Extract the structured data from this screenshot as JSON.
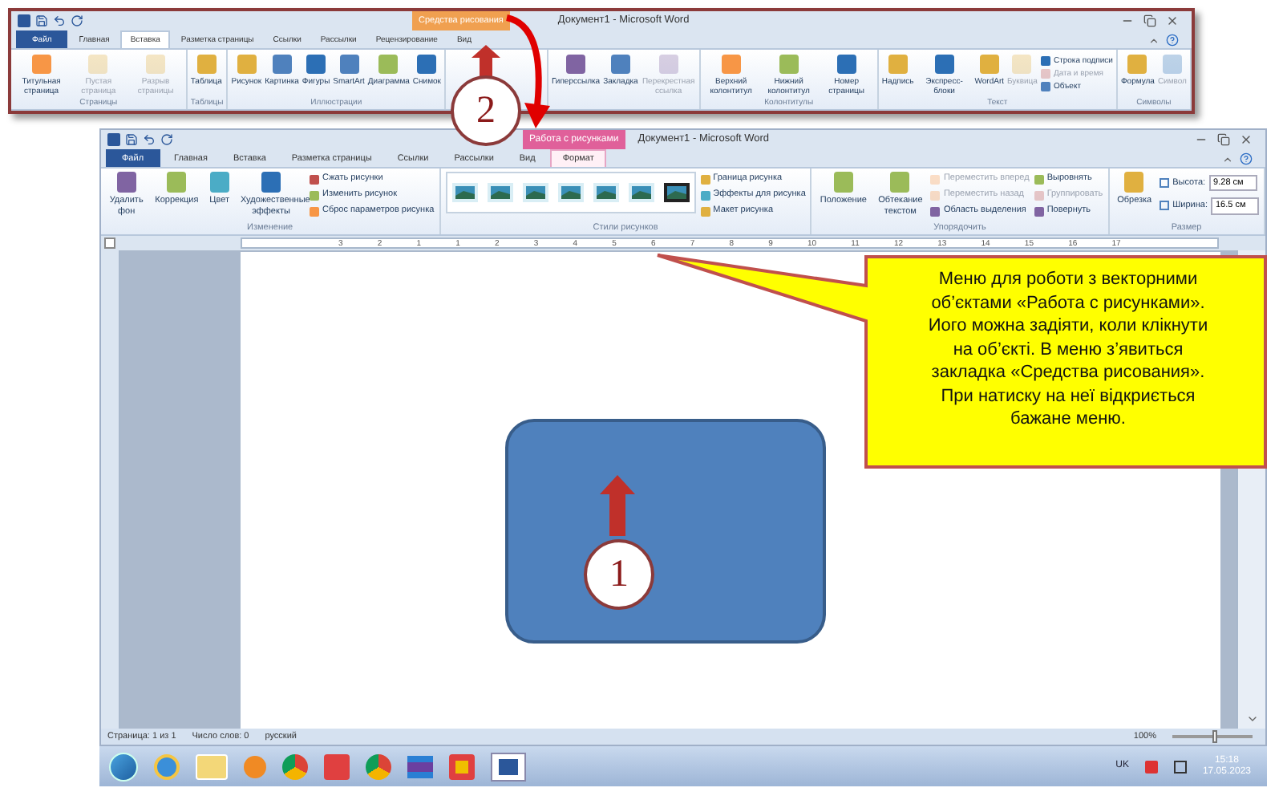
{
  "top_window": {
    "title": "Документ1 - Microsoft Word",
    "contextual_tab": "Средства рисования",
    "tabs": [
      {
        "label": "Файл",
        "kind": "file",
        "selected": false
      },
      {
        "label": "Главная",
        "kind": "normal",
        "selected": false
      },
      {
        "label": "Вставка",
        "kind": "normal",
        "selected": true
      },
      {
        "label": "Разметка страницы",
        "kind": "normal",
        "selected": false
      },
      {
        "label": "Ссылки",
        "kind": "normal",
        "selected": false
      },
      {
        "label": "Рассылки",
        "kind": "normal",
        "selected": false
      },
      {
        "label": "Рецензирование",
        "kind": "normal",
        "selected": false
      },
      {
        "label": "Вид",
        "kind": "normal",
        "selected": false
      }
    ],
    "groups": [
      {
        "label": "Страницы",
        "items": [
          {
            "kind": "large",
            "label": "Титульная страница",
            "disabled": false
          },
          {
            "kind": "large",
            "label": "Пустая страница",
            "disabled": true
          },
          {
            "kind": "large",
            "label": "Разрыв страницы",
            "disabled": true
          }
        ]
      },
      {
        "label": "Таблицы",
        "items": [
          {
            "kind": "large",
            "label": "Таблица",
            "disabled": false
          }
        ]
      },
      {
        "label": "Иллюстрации",
        "items": [
          {
            "kind": "large",
            "label": "Рисунок",
            "disabled": false
          },
          {
            "kind": "large",
            "label": "Картинка",
            "disabled": false
          },
          {
            "kind": "large",
            "label": "Фигуры",
            "disabled": false
          },
          {
            "kind": "large",
            "label": "SmartArt",
            "disabled": false
          },
          {
            "kind": "large",
            "label": "Диаграмма",
            "disabled": false
          },
          {
            "kind": "large",
            "label": "Снимок",
            "disabled": false
          }
        ]
      },
      {
        "items": [
          {
            "kind": "large",
            "label": "Гиперссылка",
            "disabled": false
          },
          {
            "kind": "large",
            "label": "Закладка",
            "disabled": false
          },
          {
            "kind": "large",
            "label": "Перекрестная ссылка",
            "disabled": true
          }
        ]
      },
      {
        "label": "Колонтитулы",
        "items": [
          {
            "kind": "large",
            "label": "Верхний колонтитул",
            "disabled": false
          },
          {
            "kind": "large",
            "label": "Нижний колонтитул",
            "disabled": false
          },
          {
            "kind": "large",
            "label": "Номер страницы",
            "disabled": false
          }
        ]
      },
      {
        "label": "Текст",
        "items": [
          {
            "kind": "large",
            "label": "Надпись",
            "disabled": false
          },
          {
            "kind": "large",
            "label": "Экспресс-блоки",
            "disabled": false
          },
          {
            "kind": "large",
            "label": "WordArt",
            "disabled": false
          },
          {
            "kind": "large",
            "label": "Буквица",
            "disabled": true
          },
          {
            "kind": "stack",
            "items": [
              {
                "label": "Строка подписи",
                "disabled": false
              },
              {
                "label": "Дата и время",
                "disabled": true
              },
              {
                "label": "Объект",
                "disabled": false
              }
            ]
          }
        ]
      },
      {
        "label": "Символы",
        "items": [
          {
            "kind": "large",
            "label": "Формула",
            "disabled": false
          },
          {
            "kind": "large",
            "label": "Символ",
            "disabled": true
          }
        ]
      }
    ]
  },
  "main_window": {
    "title": "Документ1 - Microsoft Word",
    "contextual_tab": "Работа с рисунками",
    "tabs": [
      {
        "label": "Файл",
        "kind": "file",
        "selected": false
      },
      {
        "label": "Главная",
        "kind": "normal",
        "selected": false
      },
      {
        "label": "Вставка",
        "kind": "normal",
        "selected": false
      },
      {
        "label": "Разметка страницы",
        "kind": "normal",
        "selected": false
      },
      {
        "label": "Ссылки",
        "kind": "normal",
        "selected": false
      },
      {
        "label": "Рассылки",
        "kind": "normal",
        "selected": false
      },
      {
        "label": "Вид",
        "kind": "normal",
        "selected": false
      },
      {
        "label": "Формат",
        "kind": "contextual",
        "selected": true
      }
    ],
    "groups": [
      {
        "label": "Изменение",
        "items": [
          {
            "kind": "large",
            "label": "Удалить фон",
            "disabled": false
          },
          {
            "kind": "large",
            "label": "Коррекция",
            "disabled": false
          },
          {
            "kind": "large",
            "label": "Цвет",
            "disabled": false
          },
          {
            "kind": "large",
            "label": "Художественные эффекты",
            "disabled": false
          },
          {
            "kind": "stack",
            "items": [
              {
                "label": "Сжать рисунки",
                "disabled": false
              },
              {
                "label": "Изменить рисунок",
                "disabled": false
              },
              {
                "label": "Сброс параметров рисунка",
                "disabled": false
              }
            ]
          }
        ]
      },
      {
        "label": "Стили рисунков",
        "items": [
          {
            "kind": "gallery"
          },
          {
            "kind": "stack",
            "items": [
              {
                "label": "Граница рисунка",
                "disabled": false
              },
              {
                "label": "Эффекты для рисунка",
                "disabled": false
              },
              {
                "label": "Макет рисунка",
                "disabled": false
              }
            ]
          }
        ]
      },
      {
        "label": "Упорядочить",
        "items": [
          {
            "kind": "large",
            "label": "Положение",
            "disabled": false
          },
          {
            "kind": "large",
            "label": "Обтекание текстом",
            "disabled": false
          },
          {
            "kind": "stack",
            "items": [
              {
                "label": "Переместить вперед",
                "disabled": true
              },
              {
                "label": "Переместить назад",
                "disabled": true
              },
              {
                "label": "Область выделения",
                "disabled": false
              }
            ]
          },
          {
            "kind": "stack",
            "items": [
              {
                "label": "Выровнять",
                "disabled": false
              },
              {
                "label": "Группировать",
                "disabled": true
              },
              {
                "label": "Повернуть",
                "disabled": false
              }
            ]
          }
        ]
      },
      {
        "label": "Размер",
        "items": [
          {
            "kind": "large",
            "label": "Обрезка",
            "disabled": false
          },
          {
            "kind": "fields",
            "items": [
              {
                "label": "Высота:",
                "value": "9.28 см"
              },
              {
                "label": "Ширина:",
                "value": "16.5 см"
              }
            ]
          }
        ]
      }
    ],
    "ruler": [
      "3",
      "2",
      "1",
      "1",
      "2",
      "3",
      "4",
      "5",
      "6",
      "7",
      "8",
      "9",
      "10",
      "11",
      "12",
      "13",
      "14",
      "15",
      "16",
      "17"
    ],
    "status_bar": {
      "items": [
        "Страница: 1 из 1",
        "Число слов: 0",
        "русский"
      ],
      "zoom": {
        "reading": "100%",
        "level": 0.5
      }
    }
  },
  "taskbar": {
    "language": "UK",
    "time": "15:18",
    "date": "17.05.2023"
  },
  "callout": {
    "text": "Меню для роботи з векторними\nоб’єктами «Работа с рисунками».\nИого можна задіяти, коли клікнути\nна об’єкті. В меню з’явиться\nзакладка «Средства рисования».\nПри натиску на неї відкриється\nбажане меню."
  },
  "markers": [
    {
      "label": "2"
    },
    {
      "label": "1"
    }
  ]
}
